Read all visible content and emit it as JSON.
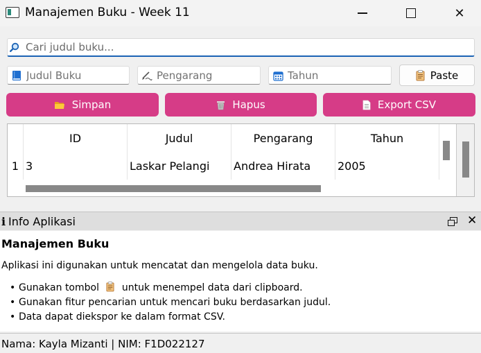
{
  "window": {
    "title": "Manajemen Buku - Week 11",
    "controls": {
      "close_glyph": "✕"
    }
  },
  "search": {
    "placeholder": "Cari judul buku...",
    "value": "",
    "icon": "search-icon"
  },
  "form": {
    "judul_placeholder": "Judul Buku",
    "pengarang_placeholder": "Pengarang",
    "tahun_placeholder": "Tahun",
    "paste_label": "Paste",
    "icons": {
      "judul": "book-icon",
      "pengarang": "pen-icon",
      "tahun": "calendar-icon",
      "paste": "clipboard-icon"
    }
  },
  "actions": {
    "simpan_label": "Simpan",
    "hapus_label": "Hapus",
    "export_label": "Export CSV",
    "icons": {
      "simpan": "folder-icon",
      "hapus": "trash-icon",
      "export": "document-icon"
    },
    "button_color": "#d63c87"
  },
  "table": {
    "headers": [
      "ID",
      "Judul",
      "Pengarang",
      "Tahun"
    ],
    "rows": [
      {
        "row_number": "1",
        "id": "3",
        "judul": "Laskar Pelangi",
        "pengarang": "Andrea Hirata",
        "tahun": "2005"
      }
    ]
  },
  "dock": {
    "title": "Info Aplikasi",
    "info_glyph": "i",
    "close_glyph": "✕",
    "heading": "Manajemen Buku",
    "description": "Aplikasi ini digunakan untuk mencatat dan mengelola data buku.",
    "bullets": {
      "b1_before": "Gunakan tombol",
      "b1_after": "untuk menempel data dari clipboard.",
      "b2": "Gunakan fitur pencarian untuk mencari buku berdasarkan judul.",
      "b3": "Data dapat diekspor ke dalam format CSV."
    }
  },
  "status": {
    "text": "Nama: Kayla Mizanti | NIM: F1D022127"
  }
}
